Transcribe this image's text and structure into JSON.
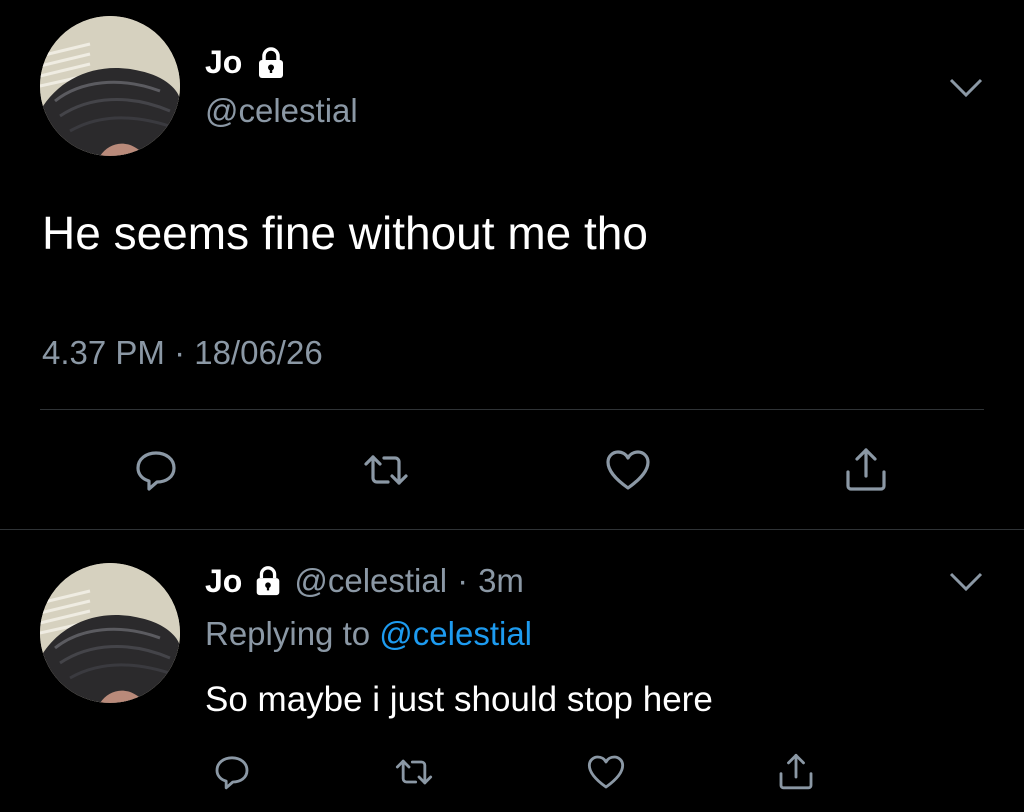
{
  "main_tweet": {
    "author_name": "Jo",
    "handle": "@celestial",
    "text": "He seems fine without me tho",
    "timestamp": "4.37 PM · 18/06/26",
    "icons": [
      "lock-icon",
      "chevron-down-icon",
      "reply-icon",
      "retweet-icon",
      "like-icon",
      "share-icon"
    ]
  },
  "reply_tweet": {
    "author_name": "Jo",
    "handle": "@celestial",
    "separator": "·",
    "time_ago": "3m",
    "replying_prefix": "Replying to",
    "replying_to": "@celestial",
    "text": "So maybe i just should stop here",
    "icons": [
      "lock-icon",
      "chevron-down-icon",
      "reply-icon",
      "retweet-icon",
      "like-icon",
      "share-icon"
    ]
  },
  "colors": {
    "background": "#000000",
    "text_primary": "#ffffff",
    "text_secondary": "#8b98a5",
    "link": "#1d9bf0",
    "divider": "#2f3336"
  }
}
